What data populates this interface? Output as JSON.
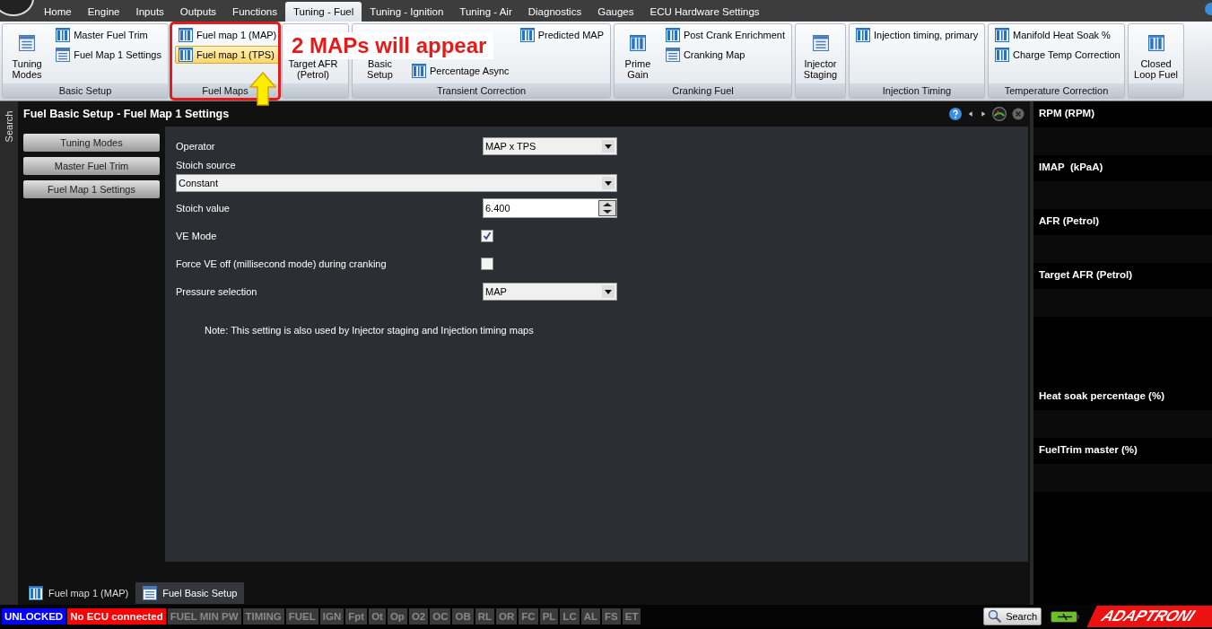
{
  "menu_tabs": [
    {
      "label": "Home",
      "selected": false
    },
    {
      "label": "Engine",
      "selected": false
    },
    {
      "label": "Inputs",
      "selected": false
    },
    {
      "label": "Outputs",
      "selected": false
    },
    {
      "label": "Functions",
      "selected": false
    },
    {
      "label": "Tuning - Fuel",
      "selected": true
    },
    {
      "label": "Tuning - Ignition",
      "selected": false
    },
    {
      "label": "Tuning - Air",
      "selected": false
    },
    {
      "label": "Diagnostics",
      "selected": false
    },
    {
      "label": "Gauges",
      "selected": false
    },
    {
      "label": "ECU Hardware Settings",
      "selected": false
    }
  ],
  "ribbon": [
    {
      "kind": "standard",
      "label": "Basic Setup",
      "items": [
        {
          "kind": "large-list",
          "label": "Tuning Modes",
          "selected": false
        },
        {
          "kind": "small-table",
          "label": "Master Fuel Trim",
          "selected": false
        },
        {
          "kind": "small-list",
          "label": "Fuel Map 1 Settings",
          "selected": false
        }
      ]
    },
    {
      "kind": "standard",
      "label": "Fuel Maps",
      "highlighted": true,
      "items": [
        {
          "kind": "small-table",
          "label": "Fuel map 1 (MAP)",
          "selected": false
        },
        {
          "kind": "small-table",
          "label": "Fuel map 1 (TPS)",
          "selected": true
        }
      ]
    },
    {
      "kind": "standard",
      "items": [
        {
          "kind": "large-covered",
          "label": "Target AFR (Petrol)",
          "selected": false
        }
      ]
    },
    {
      "kind": "split",
      "label": "Transient Correction",
      "items": [
        {
          "kind": "large-covered",
          "label": "Basic Setup",
          "selected": false
        },
        {
          "kind": "small-table",
          "label": "Percentage Async",
          "selected": false
        },
        {
          "kind": "small-table",
          "label": "Predicted MAP",
          "selected": false
        }
      ]
    },
    {
      "kind": "standard",
      "label": "Cranking Fuel",
      "items": [
        {
          "kind": "large-table",
          "label": "Prime Gain",
          "selected": false
        },
        {
          "kind": "small-table",
          "label": "Post Crank Enrichment",
          "selected": false
        },
        {
          "kind": "small-list",
          "label": "Cranking Map",
          "selected": false
        }
      ]
    },
    {
      "kind": "standard",
      "items": [
        {
          "kind": "large-list",
          "label": "Injector Staging",
          "selected": false
        }
      ]
    },
    {
      "kind": "standard",
      "label": "Injection Timing",
      "items": [
        {
          "kind": "small-table",
          "label": "Injection timing, primary",
          "selected": false
        }
      ]
    },
    {
      "kind": "standard",
      "label": "Temperature Correction",
      "items": [
        {
          "kind": "small-table",
          "label": "Manifold Heat Soak %",
          "selected": false
        },
        {
          "kind": "small-table",
          "label": "Charge Temp Correction",
          "selected": false
        }
      ]
    },
    {
      "kind": "standard",
      "items": [
        {
          "kind": "large-table",
          "label": "Closed Loop Fuel",
          "selected": false
        }
      ]
    }
  ],
  "annotation": {
    "text": "2 MAPs will appear"
  },
  "side_tab": "Search",
  "document": {
    "title": "Fuel Basic Setup - Fuel Map 1 Settings",
    "nav": [
      "Tuning Modes",
      "Master Fuel Trim",
      "Fuel Map 1 Settings"
    ],
    "fields": [
      {
        "kind": "select",
        "label": "Operator",
        "value": "MAP x TPS"
      },
      {
        "kind": "wide-select",
        "label": "Stoich source",
        "value": "Constant"
      },
      {
        "kind": "spin",
        "label": "Stoich value",
        "value": "6.400"
      },
      {
        "kind": "checkbox",
        "label": "VE Mode",
        "checked": true
      },
      {
        "kind": "checkbox",
        "label": "Force VE off (millisecond mode) during cranking",
        "checked": false
      },
      {
        "kind": "select",
        "label": "Pressure selection",
        "value": "MAP"
      }
    ],
    "note": "Note: This setting is also used by Injector staging and Injection timing maps"
  },
  "doc_tabs": [
    {
      "kind": "table",
      "label": "Fuel map 1 (MAP)",
      "selected": false
    },
    {
      "kind": "list",
      "label": "Fuel Basic Setup",
      "selected": true
    }
  ],
  "gauge_groups": [
    [
      "RPM (RPM)",
      "IMAP  (kPaA)",
      "AFR (Petrol)",
      "Target AFR (Petrol)"
    ],
    [
      "Heat soak percentage (%)",
      "FuelTrim master (%)"
    ]
  ],
  "status": [
    {
      "label": "UNLOCKED",
      "color": "#0000ff"
    },
    {
      "label": "No ECU connected",
      "color": "#ff0000"
    },
    {
      "label": "FUEL MIN PW",
      "color": "#3a3a3a"
    },
    {
      "label": "TIMING",
      "color": "#3a3a3a"
    },
    {
      "label": "FUEL",
      "color": "#3a3a3a"
    },
    {
      "label": "IGN",
      "color": "#3a3a3a"
    },
    {
      "label": "Fpt",
      "color": "#3a3a3a"
    },
    {
      "label": "Ot",
      "color": "#3a3a3a"
    },
    {
      "label": "Op",
      "color": "#3a3a3a"
    },
    {
      "label": "O2",
      "color": "#3a3a3a"
    },
    {
      "label": "OC",
      "color": "#3a3a3a"
    },
    {
      "label": "OB",
      "color": "#3a3a3a"
    },
    {
      "label": "RL",
      "color": "#3a3a3a"
    },
    {
      "label": "OR",
      "color": "#3a3a3a"
    },
    {
      "label": "FC",
      "color": "#3a3a3a"
    },
    {
      "label": "PL",
      "color": "#3a3a3a"
    },
    {
      "label": "LC",
      "color": "#3a3a3a"
    },
    {
      "label": "AL",
      "color": "#3a3a3a"
    },
    {
      "label": "FS",
      "color": "#3a3a3a"
    },
    {
      "label": "ET",
      "color": "#3a3a3a"
    }
  ],
  "search_button": "Search",
  "logo": "ADAPTRONI"
}
